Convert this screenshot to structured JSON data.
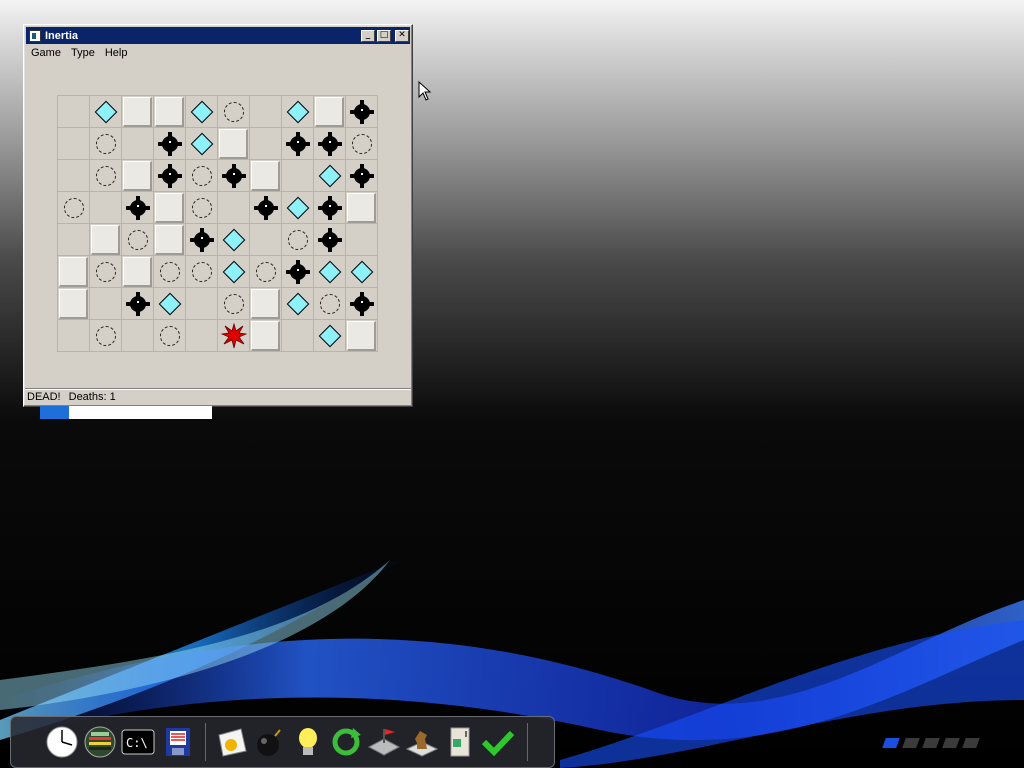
{
  "window": {
    "title": "Inertia",
    "controls": {
      "minimize": "_",
      "maximize": "□",
      "close": "✕"
    },
    "menu": [
      "Game",
      "Type",
      "Help"
    ],
    "status": {
      "message": "DEAD!",
      "deaths": "Deaths: 1"
    }
  },
  "board": {
    "rows": [
      [
        "blank",
        "gem",
        "wall",
        "wall",
        "gem",
        "stop",
        "blank",
        "gem",
        "wall",
        "mine"
      ],
      [
        "blank",
        "stop",
        "blank",
        "mine",
        "gem",
        "wall",
        "blank",
        "mine",
        "mine",
        "stop"
      ],
      [
        "blank",
        "stop",
        "wall",
        "mine",
        "stop",
        "mine",
        "wall",
        "blank",
        "gem",
        "mine"
      ],
      [
        "stop",
        "blank",
        "mine",
        "wall",
        "stop",
        "blank",
        "mine",
        "gem",
        "mine",
        "wall"
      ],
      [
        "blank",
        "wall",
        "stop",
        "wall",
        "mine",
        "gem",
        "blank",
        "stop",
        "mine",
        "blank"
      ],
      [
        "wall",
        "stop",
        "wall",
        "stop",
        "stop",
        "gem",
        "stop",
        "mine",
        "gem",
        "gem"
      ],
      [
        "wall",
        "blank",
        "mine",
        "gem",
        "blank",
        "stop",
        "wall",
        "gem",
        "stop",
        "mine"
      ],
      [
        "blank",
        "stop",
        "blank",
        "stop",
        "blank",
        "player-dead",
        "wall",
        "blank",
        "gem",
        "wall"
      ]
    ]
  },
  "progress": {
    "fraction": 0.17,
    "color": "#1e6fd9"
  },
  "dock": {
    "launchers": [
      "clock-icon",
      "calculator-icon",
      "terminal-icon",
      "save-disk-icon",
      "sun-app-icon",
      "bomb-icon",
      "lightbulb-icon",
      "refresh-icon",
      "flag-puzzle-icon",
      "chess-knight-icon",
      "fridge-icon",
      "checkmark-icon"
    ],
    "terminal_label": "C:\\"
  },
  "workspaces": {
    "count": 5,
    "active": 1
  },
  "colors": {
    "titlebar": "#0a246a",
    "window_bg": "#d4d0c8",
    "gem": "#8ff1f7",
    "explosion": "#e00000"
  }
}
